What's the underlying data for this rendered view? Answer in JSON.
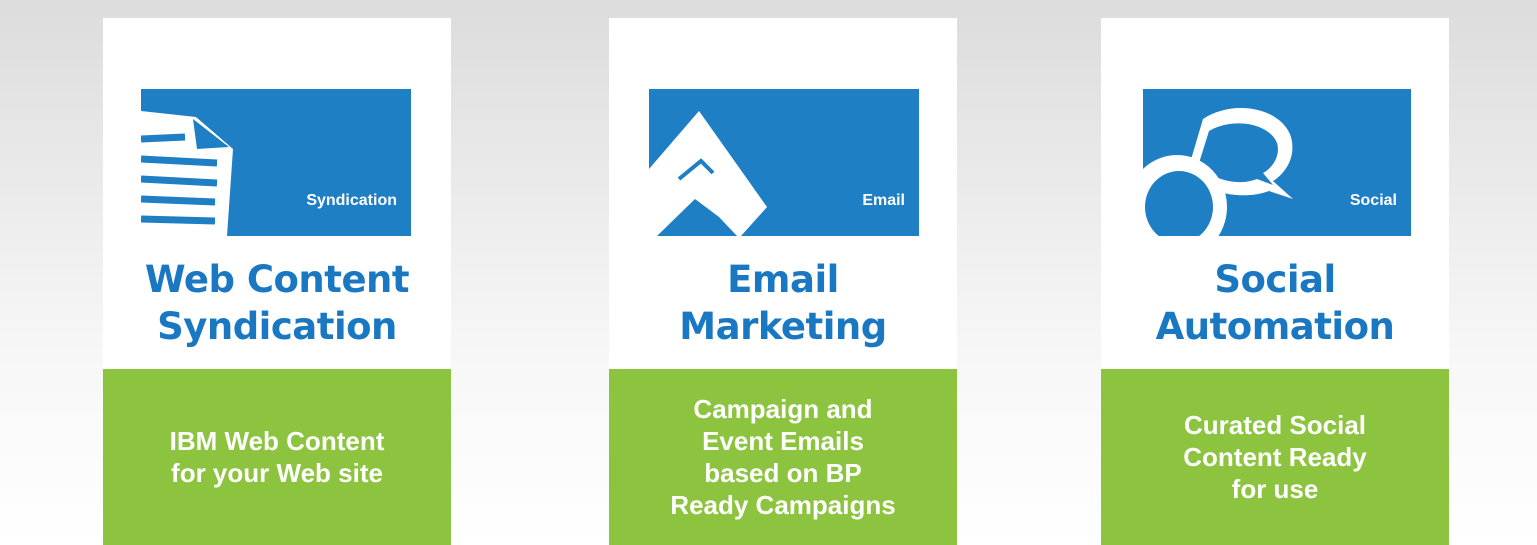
{
  "cards": [
    {
      "icon": "document-icon",
      "tile_label": "Syndication",
      "title": [
        "Web Content",
        "Syndication"
      ],
      "description": [
        "IBM Web Content",
        "for your Web site"
      ]
    },
    {
      "icon": "envelope-icon",
      "tile_label": "Email",
      "title": [
        "Email",
        "Marketing"
      ],
      "description": [
        "Campaign and",
        "Event Emails",
        "based on BP",
        "Ready Campaigns"
      ]
    },
    {
      "icon": "speech-bubble-icon",
      "tile_label": "Social",
      "title": [
        "Social",
        "Automation"
      ],
      "description": [
        "Curated Social",
        "Content Ready",
        "for use"
      ]
    }
  ],
  "colors": {
    "tile_blue": "#1f7fc4",
    "title_blue": "#1a78c2",
    "desc_green": "#8dc43f"
  }
}
